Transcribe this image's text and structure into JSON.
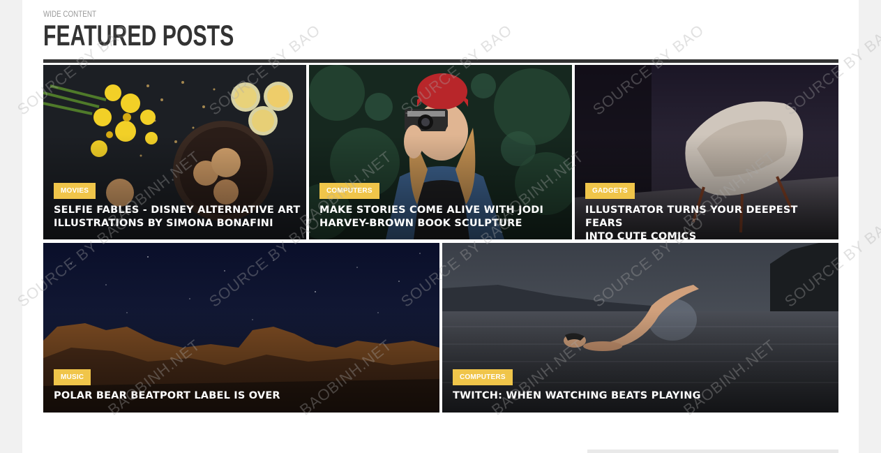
{
  "section": {
    "kicker": "WIDE CONTENT",
    "title": "FEATURED POSTS"
  },
  "posts": [
    {
      "category": "MOVIES",
      "title_line1": "SELFIE FABLES - DISNEY ALTERNATIVE ART",
      "title_line2": "ILLUSTRATIONS BY SIMONA BONAFINI",
      "image": "food-flatlay-photo"
    },
    {
      "category": "COMPUTERS",
      "title_line1": "MAKE STORIES COME ALIVE WITH JODI",
      "title_line2": "HARVEY-BROWN BOOK SCULPTURE",
      "image": "woman-with-camera-photo"
    },
    {
      "category": "GADGETS",
      "title_line1": "ILLUSTRATOR TURNS YOUR DEEPEST FEARS",
      "title_line2": "INTO CUTE COMICS",
      "image": "chair-photo"
    },
    {
      "category": "MUSIC",
      "title_line1": "POLAR BEAR BEATPORT LABEL IS OVER",
      "title_line2": "",
      "image": "night-mountains-photo"
    },
    {
      "category": "COMPUTERS",
      "title_line1": "TWITCH: WHEN WATCHING BEATS PLAYING",
      "title_line2": "",
      "image": "swimmer-photo"
    }
  ],
  "watermarks": {
    "source": "SOURCE BY BAO",
    "site": "BAOBINH.NET"
  },
  "colors": {
    "badge": "#f0c54a",
    "title_text": "#333333",
    "rule": "#333333"
  }
}
